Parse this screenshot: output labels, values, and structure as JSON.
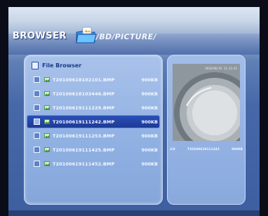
{
  "header": {
    "title": "BROWSER",
    "path": "/BD/PICTURE/"
  },
  "file_list": {
    "title": "File Browser",
    "rows": [
      {
        "name": "T20100618102101.BMP",
        "size": "900KB",
        "selected": false
      },
      {
        "name": "T20100618103446.BMP",
        "size": "900KB",
        "selected": false
      },
      {
        "name": "T20100619111229.BMP",
        "size": "900KB",
        "selected": false
      },
      {
        "name": "T20100619111242.BMP",
        "size": "900KB",
        "selected": true
      },
      {
        "name": "T20100619111253.BMP",
        "size": "900KB",
        "selected": false
      },
      {
        "name": "T20100619111425.BMP",
        "size": "900KB",
        "selected": false
      },
      {
        "name": "T20100619111452.BMP",
        "size": "900KB",
        "selected": false
      }
    ]
  },
  "preview": {
    "stamp": "2010/06/19 11:12:42",
    "index": "2/8",
    "filename": "T20100619111242",
    "size": "900KB"
  },
  "colors": {
    "selected_row": "#1d3a95",
    "text": "#f4f8ff"
  }
}
